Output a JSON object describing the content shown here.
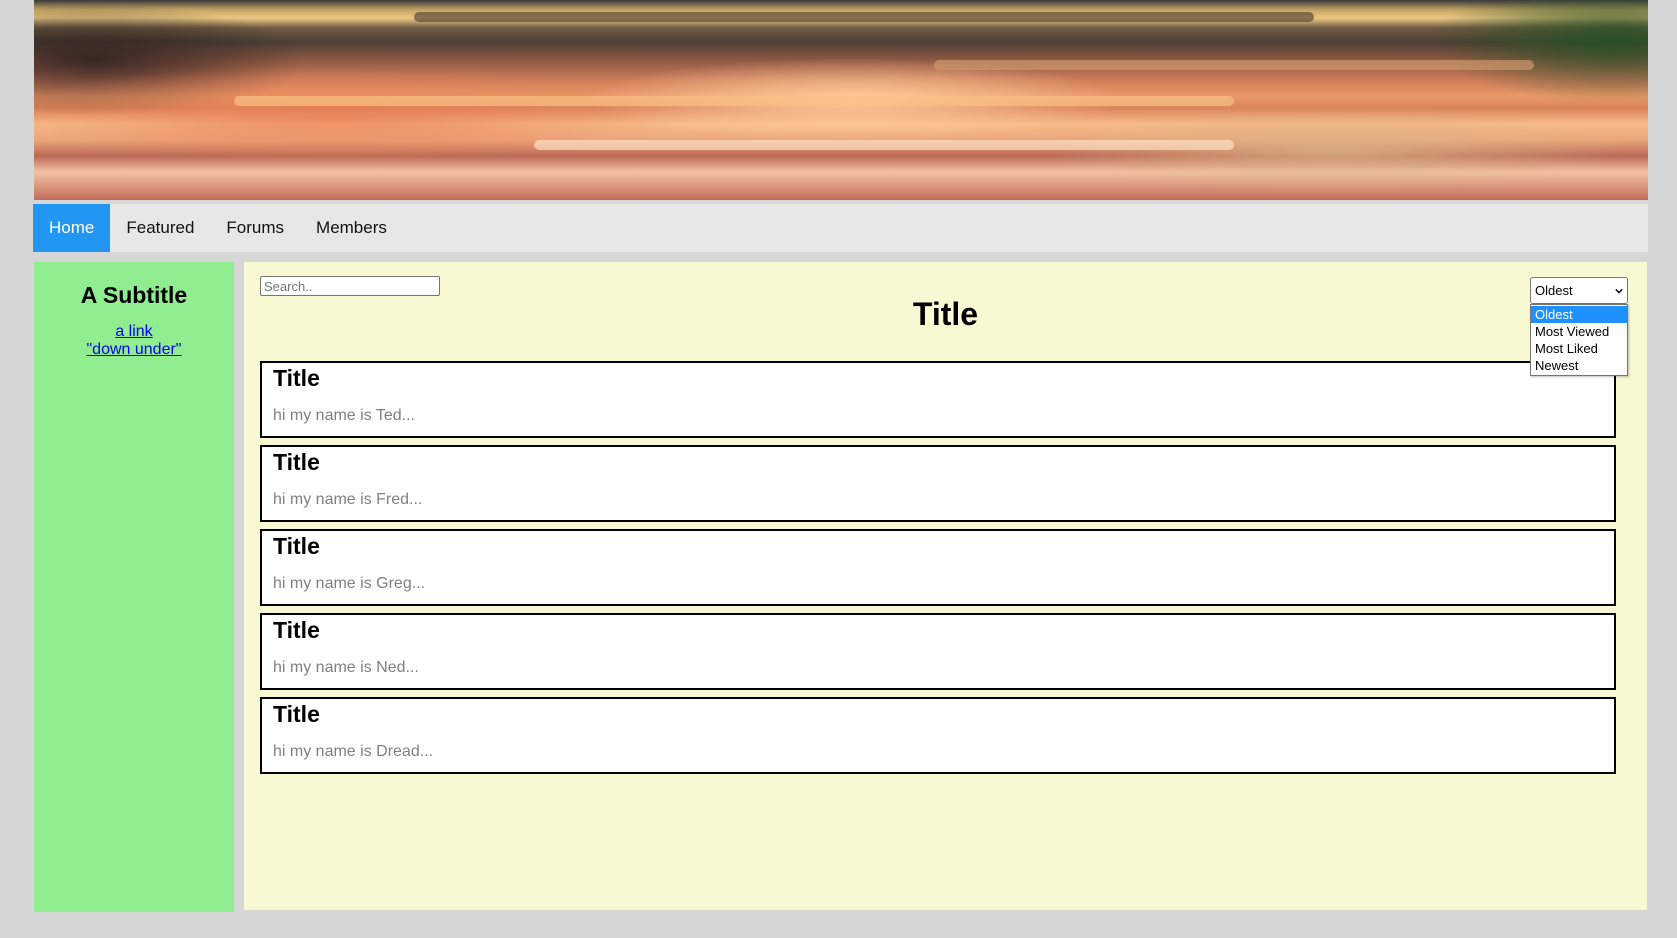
{
  "banner": {
    "alt": "header photo"
  },
  "nav": {
    "items": [
      {
        "label": "Home",
        "active": true
      },
      {
        "label": "Featured",
        "active": false
      },
      {
        "label": "Forums",
        "active": false
      },
      {
        "label": "Members",
        "active": false
      }
    ]
  },
  "sidebar": {
    "subtitle": "A Subtitle",
    "links": [
      "a link",
      "\"down under\""
    ]
  },
  "main": {
    "search_placeholder": "Search..",
    "title": "Title",
    "sort": {
      "selected": "Oldest",
      "options": [
        "Oldest",
        "Most Viewed",
        "Most Liked",
        "Newest"
      ]
    },
    "posts": [
      {
        "title": "Title",
        "excerpt": "hi my name is Ted..."
      },
      {
        "title": "Title",
        "excerpt": "hi my name is Fred..."
      },
      {
        "title": "Title",
        "excerpt": "hi my name is Greg..."
      },
      {
        "title": "Title",
        "excerpt": "hi my name is Ned..."
      },
      {
        "title": "Title",
        "excerpt": "hi my name is Dread..."
      }
    ]
  },
  "colors": {
    "page_bg": "#d6d6d6",
    "nav_bg": "#e7e7e7",
    "nav_active": "#2196f3",
    "sidebar_bg": "#90ee90",
    "main_bg": "#f8f8d2",
    "link": "#0000ee"
  }
}
